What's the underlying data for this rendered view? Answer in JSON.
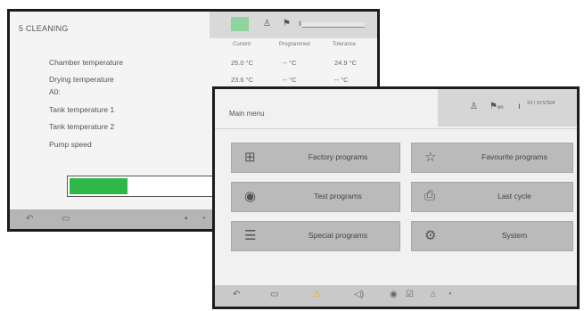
{
  "back_screen": {
    "title": "5 CLEANING",
    "columns": [
      "Current",
      "Programmed",
      "Tolerance"
    ],
    "rows": [
      {
        "label": "Chamber temperature",
        "values": [
          "25.0 °C",
          "-- °C",
          "24.9 °C"
        ]
      },
      {
        "label": "Drying temperature",
        "values": [
          "23.6 °C",
          "-- °C",
          "-- °C"
        ]
      },
      {
        "label": "A0:",
        "values": [
          "",
          "",
          ""
        ]
      },
      {
        "label": "Tank temperature 1",
        "values": [
          "",
          "",
          ""
        ]
      },
      {
        "label": "Tank temperature 2",
        "values": [
          "",
          "",
          ""
        ]
      },
      {
        "label": "Pump speed",
        "values": [
          "",
          "",
          ""
        ]
      }
    ],
    "progress_fraction": 0.33,
    "progress_color": "#2fb84a",
    "top_icons": [
      "play-icon",
      "person-icon",
      "flag-icon",
      "temperature-icon"
    ],
    "bottom_icons": [
      "back-icon",
      "book-icon",
      "info-icon",
      "clock-icon"
    ]
  },
  "front_screen": {
    "title": "Main menu",
    "top_icons": [
      "person-icon",
      "flag-icon",
      "temperature-icon"
    ],
    "top_flag_text": "en",
    "top_info": "XX / SYSTEM",
    "menu": [
      {
        "label": "Factory programs",
        "icon": "factory-programs-icon",
        "glyph": "⊞"
      },
      {
        "label": "Favourite programs",
        "icon": "star-icon",
        "glyph": "☆"
      },
      {
        "label": "Test programs",
        "icon": "eye-icon",
        "glyph": "◉"
      },
      {
        "label": "Last cycle",
        "icon": "printer-icon",
        "glyph": "⎙"
      },
      {
        "label": "Special programs",
        "icon": "special-programs-icon",
        "glyph": "☰"
      },
      {
        "label": "System",
        "icon": "gear-icon",
        "glyph": "⚙"
      }
    ],
    "bottom_icons": [
      "back-icon",
      "book-icon",
      "warning-icon",
      "speaker-icon",
      "eye-icon",
      "checklist-icon",
      "home-icon",
      "clock-icon"
    ]
  }
}
